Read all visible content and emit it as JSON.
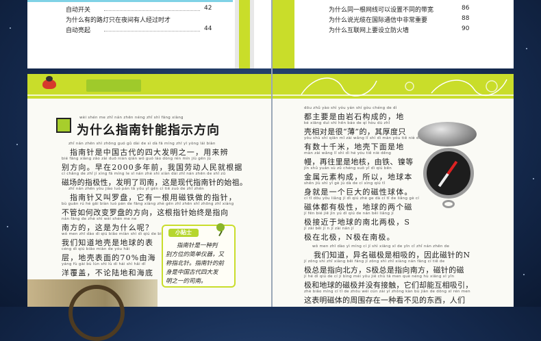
{
  "toc_left": [
    {
      "text": "自动开关",
      "page": "42"
    },
    {
      "text": "为什么有的路灯只在夜间有人经过时才",
      "page": ""
    },
    {
      "text": "自动亮起",
      "page": "44"
    }
  ],
  "toc_right": [
    {
      "text": "为什么同一根网线可以设置不同的带宽",
      "page": "86"
    },
    {
      "text": "为什么说光缆在国际通信中非常重要",
      "page": "88"
    },
    {
      "text": "为什么互联网上要设立防火墙",
      "page": "90"
    }
  ],
  "article": {
    "title_pinyin": "wèi shén me zhǐ nán zhēn néng zhǐ shì fāng xiàng",
    "title": "为什么指南针能指示方向",
    "left_lines": [
      {
        "pinyin": "zhǐ nán zhēn shì zhōng guó gǔ dài de sì dà fā míng zhī yī yòng lái biàn",
        "text": "指南针是中国古代的四大发明之一，用来辨"
      },
      {
        "pinyin": "bié fāng xiàng zǎo zài duō nián qián wǒ guó láo dòng rén mín jiù gēn jù",
        "text": "别方向。早在2000多年前，我国劳动人民就根据"
      },
      {
        "pinyin": "cí chǎng de zhǐ jí xìng fā míng le sī nán zhè shì xiàn dài zhǐ nán zhēn de shǐ zǔ",
        "text": "磁场的指极性，发明了司南，这是现代指南针的始祖。"
      },
      {
        "pinyin": "zhǐ nán zhēn yòu jiào luó pán tā yǒu yī gēn cí tiě zuò de zhǐ zhēn",
        "text": "指南针又叫罗盘，它有一根用磁铁做的指针，"
      },
      {
        "pinyin": "bù guǎn rú hé gǎi biàn luó pán de fāng xiàng zhè gēn zhǐ zhēn shǐ zhōng zhǐ xiàng",
        "text": "不管如何改变罗盘的方向，这根指针始终是指向"
      },
      {
        "pinyin": "nán fāng de zhè shì wèi shén me ne",
        "text": "南方的，这是为什么呢？"
      },
      {
        "pinyin": "wǒ men zhī dào dì qiú biǎo miàn shì dì qiú de biǎo",
        "text": "我们知道地壳是地球的表"
      },
      {
        "pinyin": "céng dì qiú biǎo miàn de yóu hǎi",
        "text": "层，地壳表面的70%由海"
      },
      {
        "pinyin": "yáng fù gài bù lùn shì lù dì hái shì hǎi dǐ",
        "text": "洋覆盖，不论陆地和海底"
      }
    ],
    "tips": {
      "head": "小贴士",
      "lines": [
        "指南针是一种判",
        "别方位的简单仪器，又",
        "称指北针。指南针的前",
        "身是中国古代四大发",
        "明之一的司南。"
      ]
    },
    "right_lines": [
      {
        "pinyin": "dōu zhǔ yào shì yóu yán shí gòu chéng de dì",
        "text": "都主要是由岩石构成的，地"
      },
      {
        "pinyin": "ké xiāng duì shì hěn báo de qí hòu dù zhǐ",
        "text": "壳相对是很“薄”的，其厚度只"
      },
      {
        "pinyin": "yǒu shù shí qiān mǐ zài wǎng lǐ shì dì màn yóu tiě niè děng",
        "text": "有数十千米，地壳下面是地"
      },
      {
        "pinyin": "màn zài wǎng lǐ shì dì hé yóu tiě niè děng",
        "text": "幔，再往里是地核，由铁、镍等"
      },
      {
        "pinyin": "jīn shǔ yuán sù zǔ chéng suǒ yǐ dì qiú běn",
        "text": "金属元素构成，所以，地球本"
      },
      {
        "pinyin": "shēn jiù shì yī gè jù dà de cí xìng qiú tǐ",
        "text": "身就是一个巨大的磁性球体。"
      },
      {
        "pinyin": "cí tǐ dōu yǒu liǎng jí dì qiú zhè ge dà cí tǐ de liǎng gè cí",
        "text": "磁体都有极性，地球的两个磁"
      },
      {
        "pinyin": "jí fēn bié jiē jìn yú dì qiú de nán běi liǎng jí",
        "text": "极接近于地球的南北两极，S"
      },
      {
        "pinyin": "jí zài běi jí n jí zài nán jí",
        "text": "极在北极，N极在南极。"
      },
      {
        "pinyin": "wǒ men zhī dào yì míng cí jí shì xiāng xī de yīn cǐ zhǐ nán zhēn de",
        "text": "我们知道，异名磁极是相吸的，因此磁针的N"
      },
      {
        "pinyin": "jí zǒng shì zhǐ xiàng běi fāng jí zǒng shì zhǐ xiàng nán fāng cí tiě de",
        "text": "极总是指向北方，S极总是指向南方，磁针的磁"
      },
      {
        "pinyin": "jí hé dì qiú de cí jí bìng méi yǒu jiē chù tā men què néng hù xiāng xī yǐn",
        "text": "极和地球的磁极并没有接触，它们却能互相吸引，"
      },
      {
        "pinyin": "zhè biǎo míng cí tǐ de zhōu wéi cún zài yī zhǒng kàn bù jiàn de dōng xī rén men",
        "text": "这表明磁体的周围存在一种看不见的东西，人们"
      }
    ]
  }
}
